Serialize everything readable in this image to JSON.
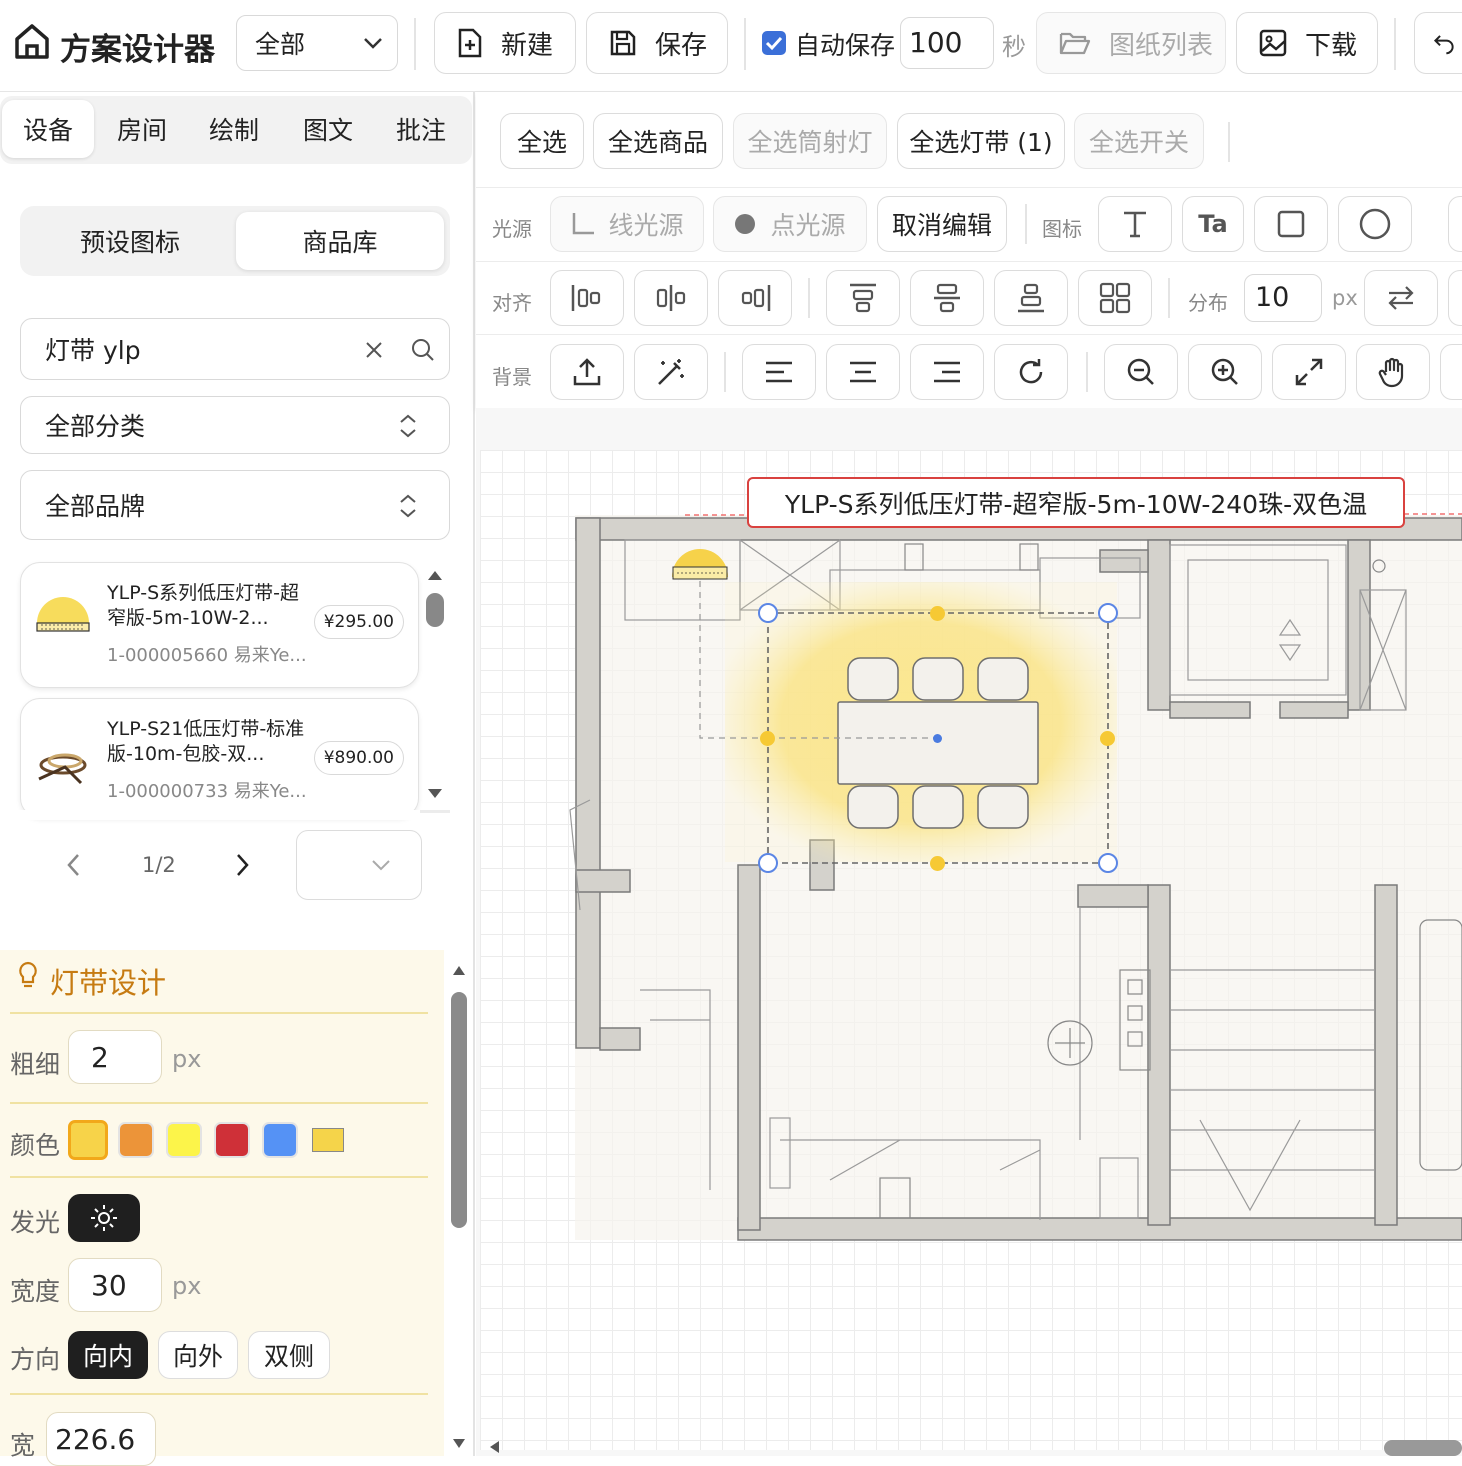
{
  "app": {
    "title": "方案设计器",
    "scope": "全部"
  },
  "toolbar": {
    "new": "新建",
    "save": "保存",
    "autosave_label": "自动保存",
    "autosave_value": "100",
    "autosave_unit": "秒",
    "list": "图纸列表",
    "download": "下载"
  },
  "left_tabs": [
    "设备",
    "房间",
    "绘制",
    "图文",
    "批注"
  ],
  "sub_tabs": [
    "预设图标",
    "商品库"
  ],
  "search": {
    "value": "灯带 ylp"
  },
  "filters": {
    "category": "全部分类",
    "brand": "全部品牌"
  },
  "products": [
    {
      "name": "YLP-S系列低压灯带-超窄版-5m-10W-2...",
      "price": "¥295.00",
      "code": "1-000005660 易来Ye..."
    },
    {
      "name": "YLP-S21低压灯带-标准版-10m-包胶-双...",
      "price": "¥890.00",
      "code": "1-000000733 易来Ye..."
    }
  ],
  "pagination": {
    "page": "1/2"
  },
  "design": {
    "title": "灯带设计",
    "thickness_label": "粗细",
    "thickness": "2",
    "unit": "px",
    "color_label": "颜色",
    "colors": [
      "#f7d349",
      "#ec9439",
      "#fcf44a",
      "#cf3038",
      "#5592f5",
      "#f5d44a"
    ],
    "glow_label": "发光",
    "width_label": "宽度",
    "width": "30",
    "direction_label": "方向",
    "directions": [
      "向内",
      "向外",
      "双侧"
    ],
    "w_label": "宽",
    "w_value": "226.6"
  },
  "select_buttons": [
    "全选",
    "全选商品",
    "全选筒射灯",
    "全选灯带 (1)",
    "全选开关"
  ],
  "row_labels": {
    "light": "光源",
    "icon": "图标",
    "align": "对齐",
    "distribute": "分布",
    "bg": "背景"
  },
  "light_buttons": {
    "line": "线光源",
    "point": "点光源",
    "cancel": "取消编辑"
  },
  "distribute": {
    "value": "10",
    "unit": "px"
  },
  "canvas": {
    "tooltip": "YLP-S系列低压灯带-超窄版-5m-10W-240珠-双色温"
  },
  "accent": "#f6d24a",
  "handle_color": "#5b86e5"
}
